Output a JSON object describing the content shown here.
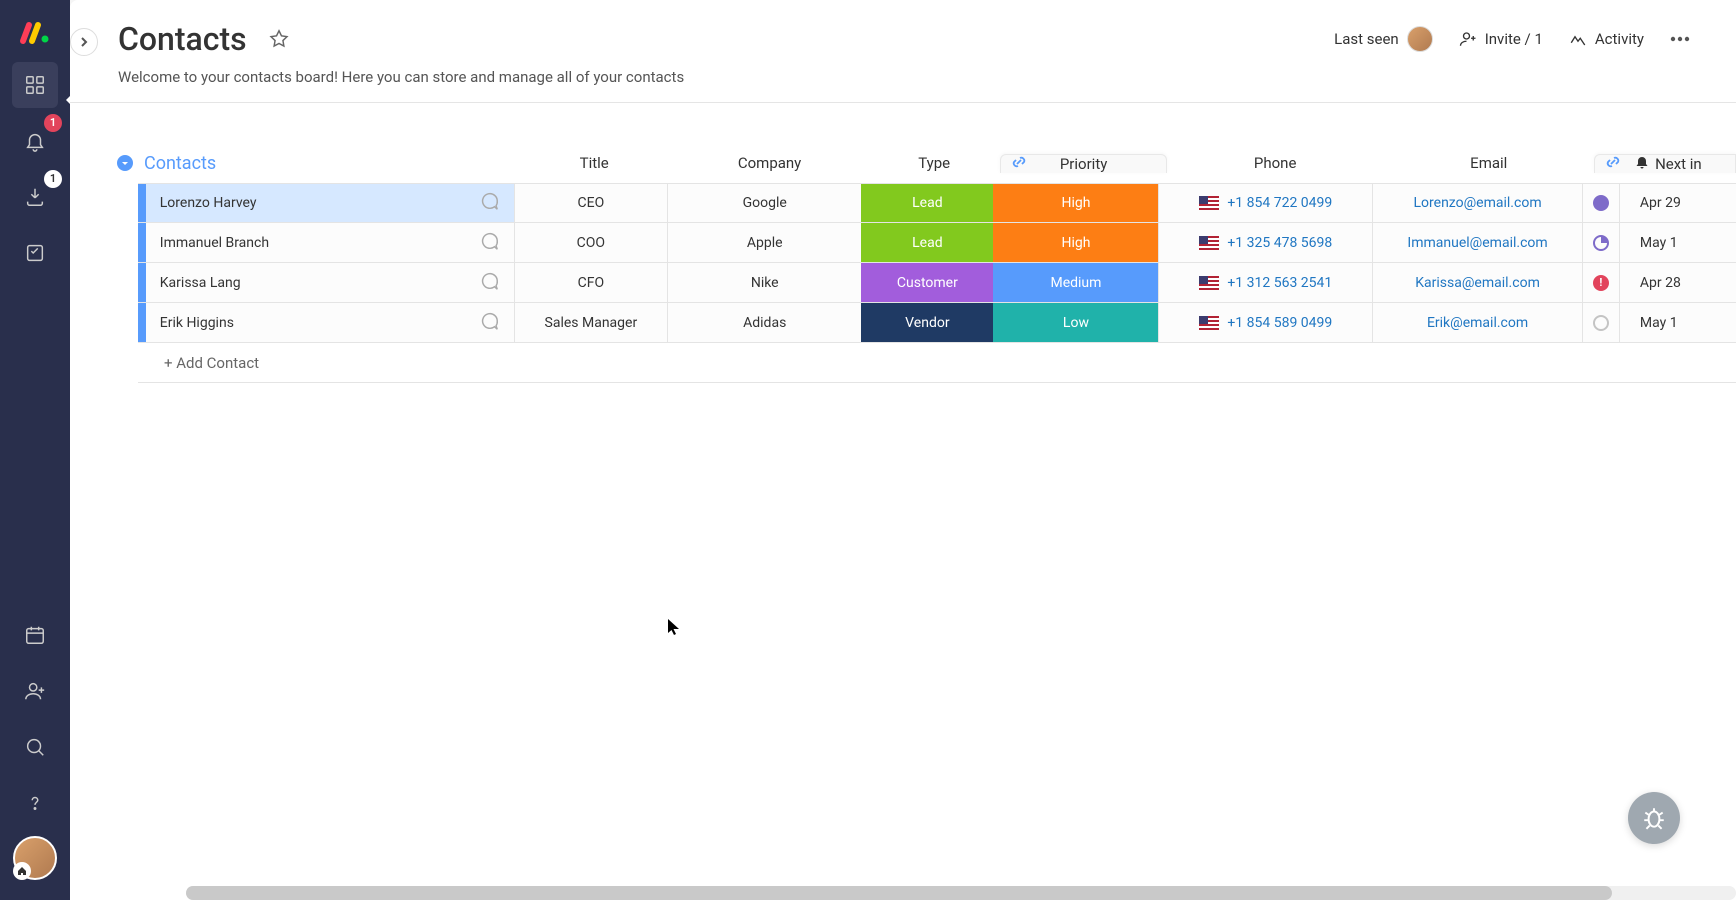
{
  "sidebar": {
    "notifications_badge": "1",
    "inbox_badge": "1"
  },
  "header": {
    "title": "Contacts",
    "description": "Welcome to your contacts board! Here you can store and manage all of your contacts",
    "last_seen_label": "Last seen",
    "invite_label": "Invite / 1",
    "activity_label": "Activity"
  },
  "group": {
    "name": "Contacts",
    "columns": {
      "title": "Title",
      "company": "Company",
      "type": "Type",
      "priority": "Priority",
      "phone": "Phone",
      "email": "Email",
      "next": "Next in"
    },
    "add_label": "+ Add Contact",
    "rows": [
      {
        "name": "Lorenzo Harvey",
        "title": "CEO",
        "company": "Google",
        "type": "Lead",
        "type_color": "#82c91e",
        "priority": "High",
        "priority_color": "#fd7e14",
        "phone": "+1 854 722 0499",
        "email": "Lorenzo@email.com",
        "status": "full-purple",
        "date": "Apr 29",
        "selected": true
      },
      {
        "name": "Immanuel Branch",
        "title": "COO",
        "company": "Apple",
        "type": "Lead",
        "type_color": "#82c91e",
        "priority": "High",
        "priority_color": "#fd7e14",
        "phone": "+1 325 478 5698",
        "email": "Immanuel@email.com",
        "status": "half-purple",
        "date": "May 1"
      },
      {
        "name": "Karissa Lang",
        "title": "CFO",
        "company": "Nike",
        "type": "Customer",
        "type_color": "#a25ddc",
        "priority": "Medium",
        "priority_color": "#579bfc",
        "phone": "+1 312 563 2541",
        "email": "Karissa@email.com",
        "status": "alert",
        "date": "Apr 28"
      },
      {
        "name": "Erik Higgins",
        "title": "Sales Manager",
        "company": "Adidas",
        "type": "Vendor",
        "type_color": "#1f3a64",
        "priority": "Low",
        "priority_color": "#20b2aa",
        "phone": "+1 854 589 0499",
        "email": "Erik@email.com",
        "status": "empty",
        "date": "May 1"
      }
    ]
  }
}
